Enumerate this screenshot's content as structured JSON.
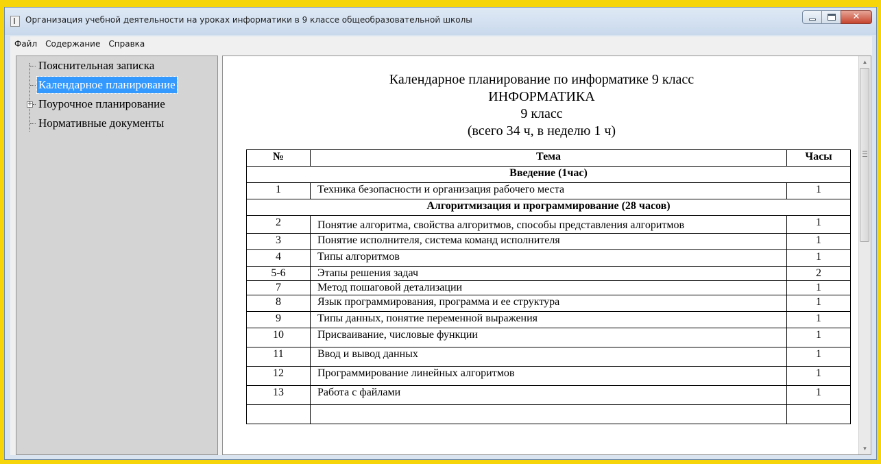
{
  "window": {
    "title": "Организация учебной деятельности на уроках  информатики в 9 классе общеобразовательной школы",
    "close_glyph": "✕"
  },
  "menu": [
    {
      "label": "Файл"
    },
    {
      "label": "Содержание"
    },
    {
      "label": "Справка"
    }
  ],
  "tree": {
    "items": [
      {
        "label": "Пояснительная записка"
      },
      {
        "label": "Календарное планирование",
        "selected": true
      },
      {
        "label": "Поурочное планирование",
        "expander": "+"
      },
      {
        "label": "Нормативные документы"
      }
    ]
  },
  "document": {
    "heading_lines": [
      "Календарное планирование по информатике 9 класс",
      "ИНФОРМАТИКА",
      "9 класс",
      "(всего 34 ч, в неделю 1 ч)"
    ],
    "columns": [
      "№",
      "Тема",
      "Часы"
    ],
    "sections": [
      {
        "title": "Введение (1час)",
        "rows": [
          {
            "num": "1",
            "topic": "Техника безопасности и организация рабочего места",
            "hours": "1"
          }
        ]
      },
      {
        "title": "Алгоритмизация и программирование (28 часов)",
        "rows": [
          {
            "num": "2",
            "topic": "Понятие алгоритма, свойства алгоритмов, способы представления алгоритмов",
            "hours": "1"
          },
          {
            "num": "3",
            "topic": "Понятие исполнителя, система команд исполнителя",
            "hours": "1"
          },
          {
            "num": "4",
            "topic": "Типы алгоритмов",
            "hours": "1"
          },
          {
            "num": "5-6",
            "topic": "Этапы решения задач",
            "hours": "2"
          },
          {
            "num": "7",
            "topic": "Метод пошаговой детализации",
            "hours": "1"
          },
          {
            "num": "8",
            "topic": "Язык программирования, программа и ее структура",
            "hours": "1"
          },
          {
            "num": "9",
            "topic": "Типы данных, понятие переменной выражения",
            "hours": "1"
          },
          {
            "num": "10",
            "topic": "Присваивание, числовые функции",
            "hours": "1"
          },
          {
            "num": "11",
            "topic": "Ввод и вывод данных",
            "hours": "1"
          },
          {
            "num": "12",
            "topic": "Программирование линейных алгоритмов",
            "hours": "1"
          },
          {
            "num": "13",
            "topic": "Работа с файлами",
            "hours": "1"
          }
        ]
      }
    ]
  }
}
